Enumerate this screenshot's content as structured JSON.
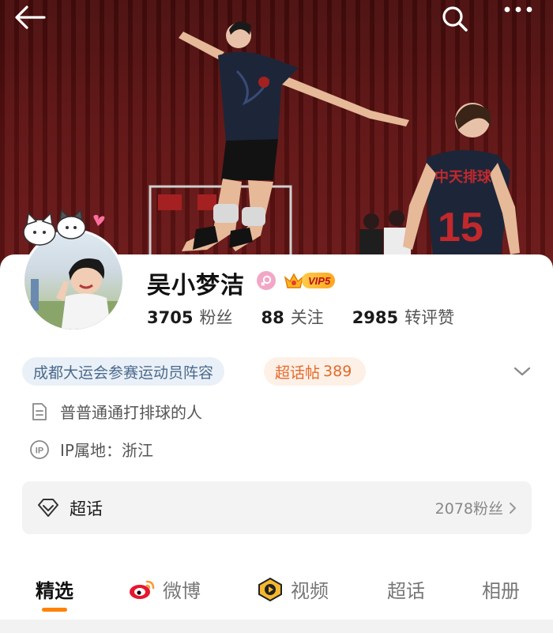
{
  "profile": {
    "name": "吴小梦洁",
    "vip_label": "VIP5"
  },
  "stats": [
    {
      "num": "3705",
      "label": "粉丝"
    },
    {
      "num": "88",
      "label": "关注"
    },
    {
      "num": "2985",
      "label": "转评赞"
    }
  ],
  "tags": {
    "event": "成都大运会参赛运动员阵容",
    "topic_label": "超话帖",
    "topic_count": "389"
  },
  "info": {
    "bio": "普普通通打排球的人",
    "ip": "IP属地：浙江"
  },
  "super_topic": {
    "label": "超话",
    "fans": "2078粉丝"
  },
  "tabs": [
    {
      "label": "精选",
      "icon": "none"
    },
    {
      "label": "微博",
      "icon": "weibo-icon"
    },
    {
      "label": "视频",
      "icon": "video-icon"
    },
    {
      "label": "超话",
      "icon": "none"
    },
    {
      "label": "相册",
      "icon": "none"
    }
  ],
  "colors": {
    "accent": "#ff8200",
    "event_tag_bg": "#eaf0f7",
    "topic_tag_text": "#e36a2a"
  },
  "cover": {
    "jersey_text": "中天排球",
    "jersey_number": "15"
  }
}
